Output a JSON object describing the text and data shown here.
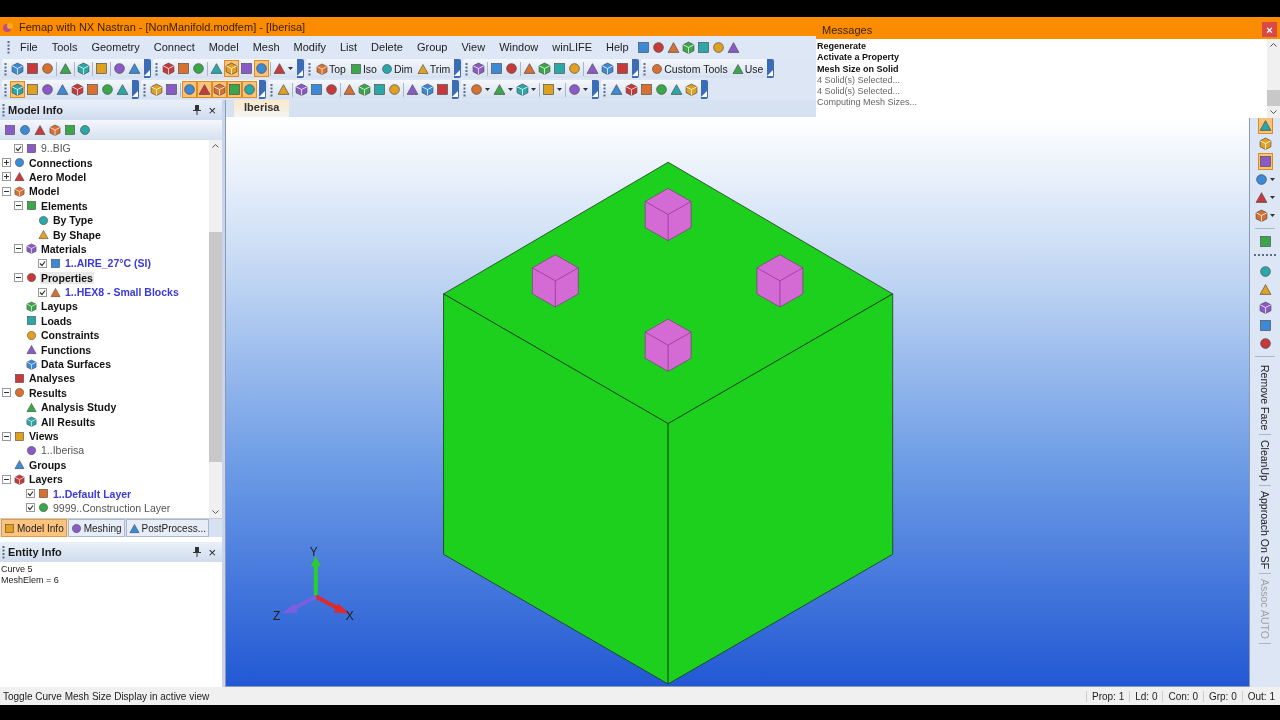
{
  "window": {
    "title": "Femap with NX Nastran - [NonManifold.modfem] - [Iberisa]"
  },
  "menu": [
    "File",
    "Tools",
    "Geometry",
    "Connect",
    "Model",
    "Mesh",
    "Modify",
    "List",
    "Delete",
    "Group",
    "View",
    "Window",
    "winLIFE",
    "Help"
  ],
  "menu_tools": [
    {
      "kind": "icon",
      "on": false
    },
    {
      "kind": "icon",
      "on": false
    },
    {
      "kind": "icon",
      "on": false
    },
    {
      "kind": "icon",
      "on": false
    },
    {
      "kind": "icon",
      "on": false
    },
    {
      "kind": "icon",
      "on": false
    },
    {
      "kind": "icon",
      "on": false
    }
  ],
  "toolbars": [
    [
      {
        "items": [
          {
            "kind": "icon",
            "on": false
          },
          {
            "kind": "icon",
            "on": false
          },
          {
            "kind": "icon",
            "on": false
          },
          {
            "kind": "sep"
          },
          {
            "kind": "icon",
            "on": false
          },
          {
            "kind": "sep"
          },
          {
            "kind": "icon",
            "on": false
          },
          {
            "kind": "sep"
          },
          {
            "kind": "icon",
            "on": false
          },
          {
            "kind": "sep"
          },
          {
            "kind": "icon",
            "on": false
          },
          {
            "kind": "icon",
            "on": false
          }
        ]
      },
      {
        "items": [
          {
            "kind": "icon",
            "on": false
          },
          {
            "kind": "icon",
            "on": false
          },
          {
            "kind": "icon",
            "on": false
          },
          {
            "kind": "sep"
          },
          {
            "kind": "icon",
            "on": false
          },
          {
            "kind": "icon",
            "on": true
          },
          {
            "kind": "icon",
            "on": false
          },
          {
            "kind": "icon",
            "on": true
          },
          {
            "kind": "sep"
          },
          {
            "kind": "dropdown",
            "on": false
          }
        ]
      },
      {
        "items": [
          {
            "kind": "text",
            "label": "Top"
          },
          {
            "kind": "text",
            "label": "Iso"
          },
          {
            "kind": "text",
            "label": "Dim"
          },
          {
            "kind": "text",
            "label": "Trim"
          }
        ]
      },
      {
        "items": [
          {
            "kind": "icon",
            "on": false
          },
          {
            "kind": "sep"
          },
          {
            "kind": "icon",
            "on": false
          },
          {
            "kind": "icon",
            "on": false
          },
          {
            "kind": "sep"
          },
          {
            "kind": "icon",
            "on": false
          },
          {
            "kind": "icon",
            "on": false
          },
          {
            "kind": "icon",
            "on": false
          },
          {
            "kind": "icon",
            "on": false
          },
          {
            "kind": "sep"
          },
          {
            "kind": "icon",
            "on": false
          },
          {
            "kind": "icon",
            "on": false
          },
          {
            "kind": "icon",
            "on": false
          }
        ]
      },
      {
        "items": [
          {
            "kind": "text",
            "label": "Custom Tools"
          },
          {
            "kind": "text",
            "label": "Use"
          }
        ]
      }
    ],
    [
      {
        "items": [
          {
            "kind": "icon",
            "on": true
          },
          {
            "kind": "icon",
            "on": false
          },
          {
            "kind": "icon",
            "on": false
          },
          {
            "kind": "icon",
            "on": false
          },
          {
            "kind": "icon",
            "on": false
          },
          {
            "kind": "icon",
            "on": false
          },
          {
            "kind": "icon",
            "on": false
          },
          {
            "kind": "icon",
            "on": false
          }
        ]
      },
      {
        "items": [
          {
            "kind": "icon",
            "on": false
          },
          {
            "kind": "icon",
            "on": false
          },
          {
            "kind": "sep"
          },
          {
            "kind": "icon",
            "on": true
          },
          {
            "kind": "icon",
            "on": true
          },
          {
            "kind": "icon",
            "on": true
          },
          {
            "kind": "icon",
            "on": true
          },
          {
            "kind": "icon",
            "on": true
          }
        ]
      },
      {
        "items": [
          {
            "kind": "icon",
            "on": false
          },
          {
            "kind": "sep"
          },
          {
            "kind": "icon",
            "on": false
          },
          {
            "kind": "icon",
            "on": false
          },
          {
            "kind": "icon",
            "on": false
          },
          {
            "kind": "sep"
          },
          {
            "kind": "icon",
            "on": false
          },
          {
            "kind": "icon",
            "on": false
          },
          {
            "kind": "icon",
            "on": false
          },
          {
            "kind": "icon",
            "on": false
          },
          {
            "kind": "sep"
          },
          {
            "kind": "icon",
            "on": false
          },
          {
            "kind": "icon",
            "on": false
          },
          {
            "kind": "icon",
            "on": false
          }
        ]
      },
      {
        "items": [
          {
            "kind": "dropdown",
            "on": false
          },
          {
            "kind": "dropdown",
            "on": false
          },
          {
            "kind": "dropdown",
            "on": false
          },
          {
            "kind": "sep"
          },
          {
            "kind": "dropdown",
            "on": false
          },
          {
            "kind": "sep"
          },
          {
            "kind": "dropdown",
            "on": false
          }
        ]
      },
      {
        "items": [
          {
            "kind": "icon",
            "on": false
          },
          {
            "kind": "icon",
            "on": false
          },
          {
            "kind": "icon",
            "on": false
          },
          {
            "kind": "icon",
            "on": false
          },
          {
            "kind": "icon",
            "on": false
          },
          {
            "kind": "icon",
            "on": false
          }
        ]
      }
    ]
  ],
  "messages": {
    "title": "Messages",
    "close": "×",
    "lines": [
      {
        "kind": "command",
        "text": "Regenerate"
      },
      {
        "kind": "command",
        "text": "Activate a Property"
      },
      {
        "kind": "command",
        "text": "Mesh Size on Solid"
      },
      {
        "kind": "info",
        "text": "4 Solid(s) Selected..."
      },
      {
        "kind": "info",
        "text": "4 Solid(s) Selected..."
      },
      {
        "kind": "info",
        "text": "Computing Mesh Sizes..."
      }
    ]
  },
  "model_info": {
    "title": "Model Info",
    "close": "×",
    "tree": [
      {
        "children": [
          {
            "label": "9..BIG",
            "checked": true,
            "active": false,
            "selected": false
          }
        ]
      },
      {
        "label": "Connections",
        "expanded": false,
        "selected": false
      },
      {
        "label": "Aero Model",
        "expanded": false,
        "selected": false
      },
      {
        "label": "Model",
        "expanded": true,
        "selected": false,
        "children": [
          {
            "label": "Elements",
            "expanded": true,
            "selected": false,
            "children": [
              {
                "label": "By Type",
                "selected": false
              },
              {
                "label": "By Shape",
                "selected": false
              }
            ]
          },
          {
            "label": "Materials",
            "expanded": true,
            "selected": false,
            "children": [
              {
                "label": "1..AIRE_27°C (SI)",
                "checked": true,
                "active": true,
                "selected": false
              }
            ]
          },
          {
            "label": "Properties",
            "expanded": true,
            "selected": true,
            "children": [
              {
                "label": "1..HEX8 - Small Blocks",
                "checked": true,
                "active": true,
                "selected": false
              }
            ]
          },
          {
            "label": "Layups",
            "selected": false
          },
          {
            "label": "Loads",
            "selected": false
          },
          {
            "label": "Constraints",
            "selected": false
          },
          {
            "label": "Functions",
            "selected": false
          },
          {
            "label": "Data Surfaces",
            "selected": false
          }
        ]
      },
      {
        "label": "Analyses",
        "selected": false
      },
      {
        "label": "Results",
        "expanded": true,
        "selected": false,
        "children": [
          {
            "label": "Analysis Study",
            "selected": false
          },
          {
            "label": "All Results",
            "selected": false
          }
        ]
      },
      {
        "label": "Views",
        "expanded": true,
        "selected": false,
        "children": [
          {
            "label": "1..Iberisa",
            "active": false,
            "selected": false
          }
        ]
      },
      {
        "label": "Groups",
        "selected": false
      },
      {
        "label": "Layers",
        "expanded": true,
        "selected": false,
        "children": [
          {
            "label": "1..Default Layer",
            "checked": true,
            "active": true,
            "selected": false
          },
          {
            "label": "9999..Construction Layer",
            "checked": true,
            "active": false,
            "selected": false
          }
        ]
      }
    ],
    "tabs": [
      {
        "label": "Model Info",
        "selected": true
      },
      {
        "label": "Meshing",
        "selected": false
      },
      {
        "label": "PostProcess...",
        "selected": false
      }
    ]
  },
  "entity_info": {
    "title": "Entity Info",
    "close": "×",
    "lines": [
      "Curve 5",
      "MeshElem = 6"
    ]
  },
  "viewport": {
    "tabs": [
      {
        "label": "Iberisa",
        "selected": true
      }
    ],
    "triad": {
      "x": "X",
      "y": "Y",
      "z": "Z"
    }
  },
  "side_toolbar": [
    {
      "kind": "icon",
      "on": true
    },
    {
      "kind": "icon",
      "on": false
    },
    {
      "kind": "icon",
      "on": true
    },
    {
      "kind": "dropdown",
      "on": false
    },
    {
      "kind": "dropdown",
      "on": false
    },
    {
      "kind": "dropdown",
      "on": false
    },
    {
      "kind": "sep"
    },
    {
      "kind": "icon",
      "on": false
    },
    {
      "kind": "grip"
    },
    {
      "kind": "icon",
      "on": false
    },
    {
      "kind": "icon",
      "on": false
    },
    {
      "kind": "icon",
      "on": false
    },
    {
      "kind": "icon",
      "on": false
    },
    {
      "kind": "icon",
      "on": false
    },
    {
      "kind": "sep"
    },
    {
      "kind": "text",
      "label": "Remove Face",
      "disabled": false
    },
    {
      "kind": "text",
      "label": "CleanUp",
      "disabled": false
    },
    {
      "kind": "text",
      "label": "Approach On SF",
      "disabled": false
    },
    {
      "kind": "text",
      "label": "Assoc AUTO",
      "disabled": true
    }
  ],
  "status_bar": {
    "message": "Toggle Curve Mesh Size Display in active view",
    "fields": [
      "Prop: 1",
      "Ld: 0",
      "Con: 0",
      "Grp: 0",
      "Out: 1"
    ]
  }
}
